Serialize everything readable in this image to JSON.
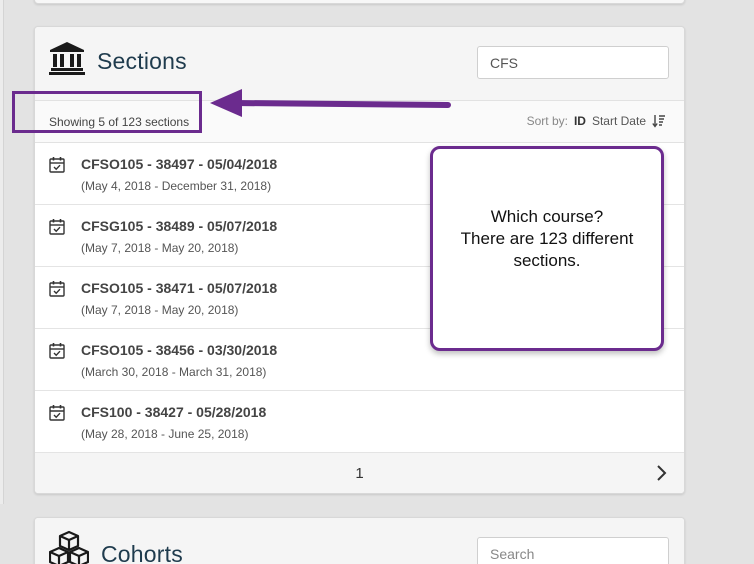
{
  "sections": {
    "title": "Sections",
    "icon": "institution-icon",
    "search_value": "CFS",
    "showing": "Showing 5 of 123 sections",
    "sort": {
      "label": "Sort by:",
      "id": "ID",
      "start_date": "Start Date",
      "icon": "sort-desc-icon"
    },
    "rows": [
      {
        "title": "CFSO105 - 38497 - 05/04/2018",
        "dates": "(May 4, 2018 - December 31, 2018)"
      },
      {
        "title": "CFSG105 - 38489 - 05/07/2018",
        "dates": "(May 7, 2018 - May 20, 2018)"
      },
      {
        "title": "CFSO105 - 38471 - 05/07/2018",
        "dates": "(May 7, 2018 - May 20, 2018)"
      },
      {
        "title": "CFSO105 - 38456 - 03/30/2018",
        "dates": "(March 30, 2018 - March 31, 2018)"
      },
      {
        "title": "CFS100 - 38427 - 05/28/2018",
        "dates": "(May 28, 2018 - June 25, 2018)"
      }
    ],
    "pager": {
      "page": "1"
    }
  },
  "cohorts": {
    "title": "Cohorts",
    "icon": "cubes-icon",
    "search_placeholder": "Search"
  },
  "annotation": {
    "callout_lines": [
      "Which course?",
      "There are 123 different",
      "sections."
    ],
    "color": "#6b2b8e"
  }
}
